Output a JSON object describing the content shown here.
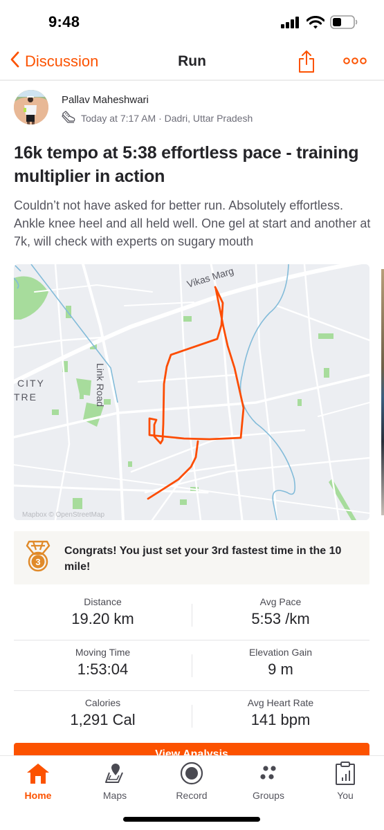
{
  "status_bar": {
    "time": "9:48",
    "icons": [
      "cellular-signal-icon",
      "wifi-icon",
      "battery-icon"
    ],
    "battery_level": 0.4
  },
  "nav": {
    "back_label": "Discussion",
    "title": "Run",
    "share_icon": "share-icon",
    "more_icon": "more-icon"
  },
  "athlete": {
    "name": "Pallav Maheshwari",
    "activity_icon": "running-shoe-icon",
    "meta": "Today at 7:17 AM · Dadri, Uttar Pradesh"
  },
  "activity": {
    "title": "16k tempo at 5:38 effortless pace - training multiplier in action",
    "description": "Couldn’t not have asked for better run. Absolutely effortless. Ankle knee heel and all held well. One gel at start and another at 7k, will check with experts on sugary mouth"
  },
  "map": {
    "labels": {
      "road_1": "Vikas Marg",
      "road_2": "Link Road",
      "area_1": "CITY",
      "area_2": "TRE",
      "attribution": "Mapbox © OpenStreetMap"
    },
    "route_color": "#fc4c02"
  },
  "achievement": {
    "icon": "medal-3rd-icon",
    "rank": "3",
    "text": "Congrats! You just set your 3rd fastest time in the 10 mile!",
    "color": "#e08a2a"
  },
  "stats": [
    [
      {
        "label": "Distance",
        "value": "19.20 km"
      },
      {
        "label": "Avg Pace",
        "value": "5:53 /km"
      }
    ],
    [
      {
        "label": "Moving Time",
        "value": "1:53:04"
      },
      {
        "label": "Elevation Gain",
        "value": "9 m"
      }
    ],
    [
      {
        "label": "Calories",
        "value": "1,291 Cal"
      },
      {
        "label": "Avg Heart Rate",
        "value": "141 bpm"
      }
    ]
  ],
  "analysis_button": {
    "label": "View Analysis"
  },
  "tab_bar": {
    "active": "Home",
    "tabs": [
      {
        "label": "Home",
        "icon": "home-icon"
      },
      {
        "label": "Maps",
        "icon": "maps-icon"
      },
      {
        "label": "Record",
        "icon": "record-icon"
      },
      {
        "label": "Groups",
        "icon": "groups-icon"
      },
      {
        "label": "You",
        "icon": "you-clipboard-icon"
      }
    ]
  },
  "colors": {
    "brand": "#fc5200",
    "text_primary": "#242428",
    "text_secondary": "#6d6d78"
  }
}
